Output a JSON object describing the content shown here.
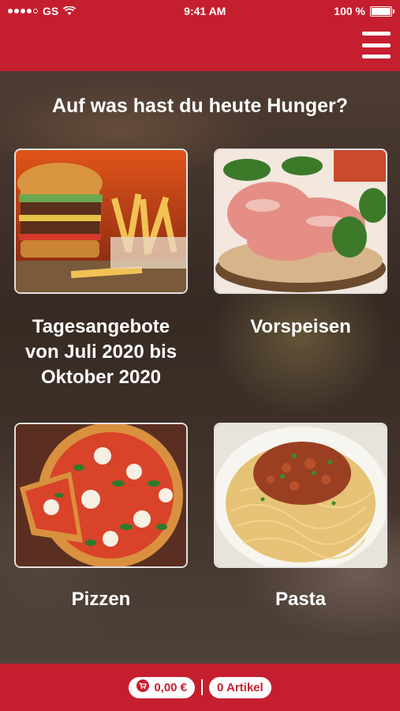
{
  "status_bar": {
    "carrier": "GS",
    "time": "9:41 AM",
    "battery": "100 %"
  },
  "header": {
    "menu_icon": "hamburger-menu-icon"
  },
  "main": {
    "headline": "Auf was hast du heute Hunger?",
    "tiles": [
      {
        "label": "Tagesangebote von Juli 2020 bis Oktober 2020",
        "image": "burger-fries"
      },
      {
        "label": "Vorspeisen",
        "image": "prosciutto-plate"
      },
      {
        "label": "Pizzen",
        "image": "pizza"
      },
      {
        "label": "Pasta",
        "image": "spaghetti-bolognese"
      }
    ]
  },
  "footer": {
    "cart_icon": "cart-icon",
    "total": "0,00 €",
    "items": "0 Artikel"
  },
  "colors": {
    "brand_red": "#c51f2f",
    "white": "#ffffff"
  }
}
